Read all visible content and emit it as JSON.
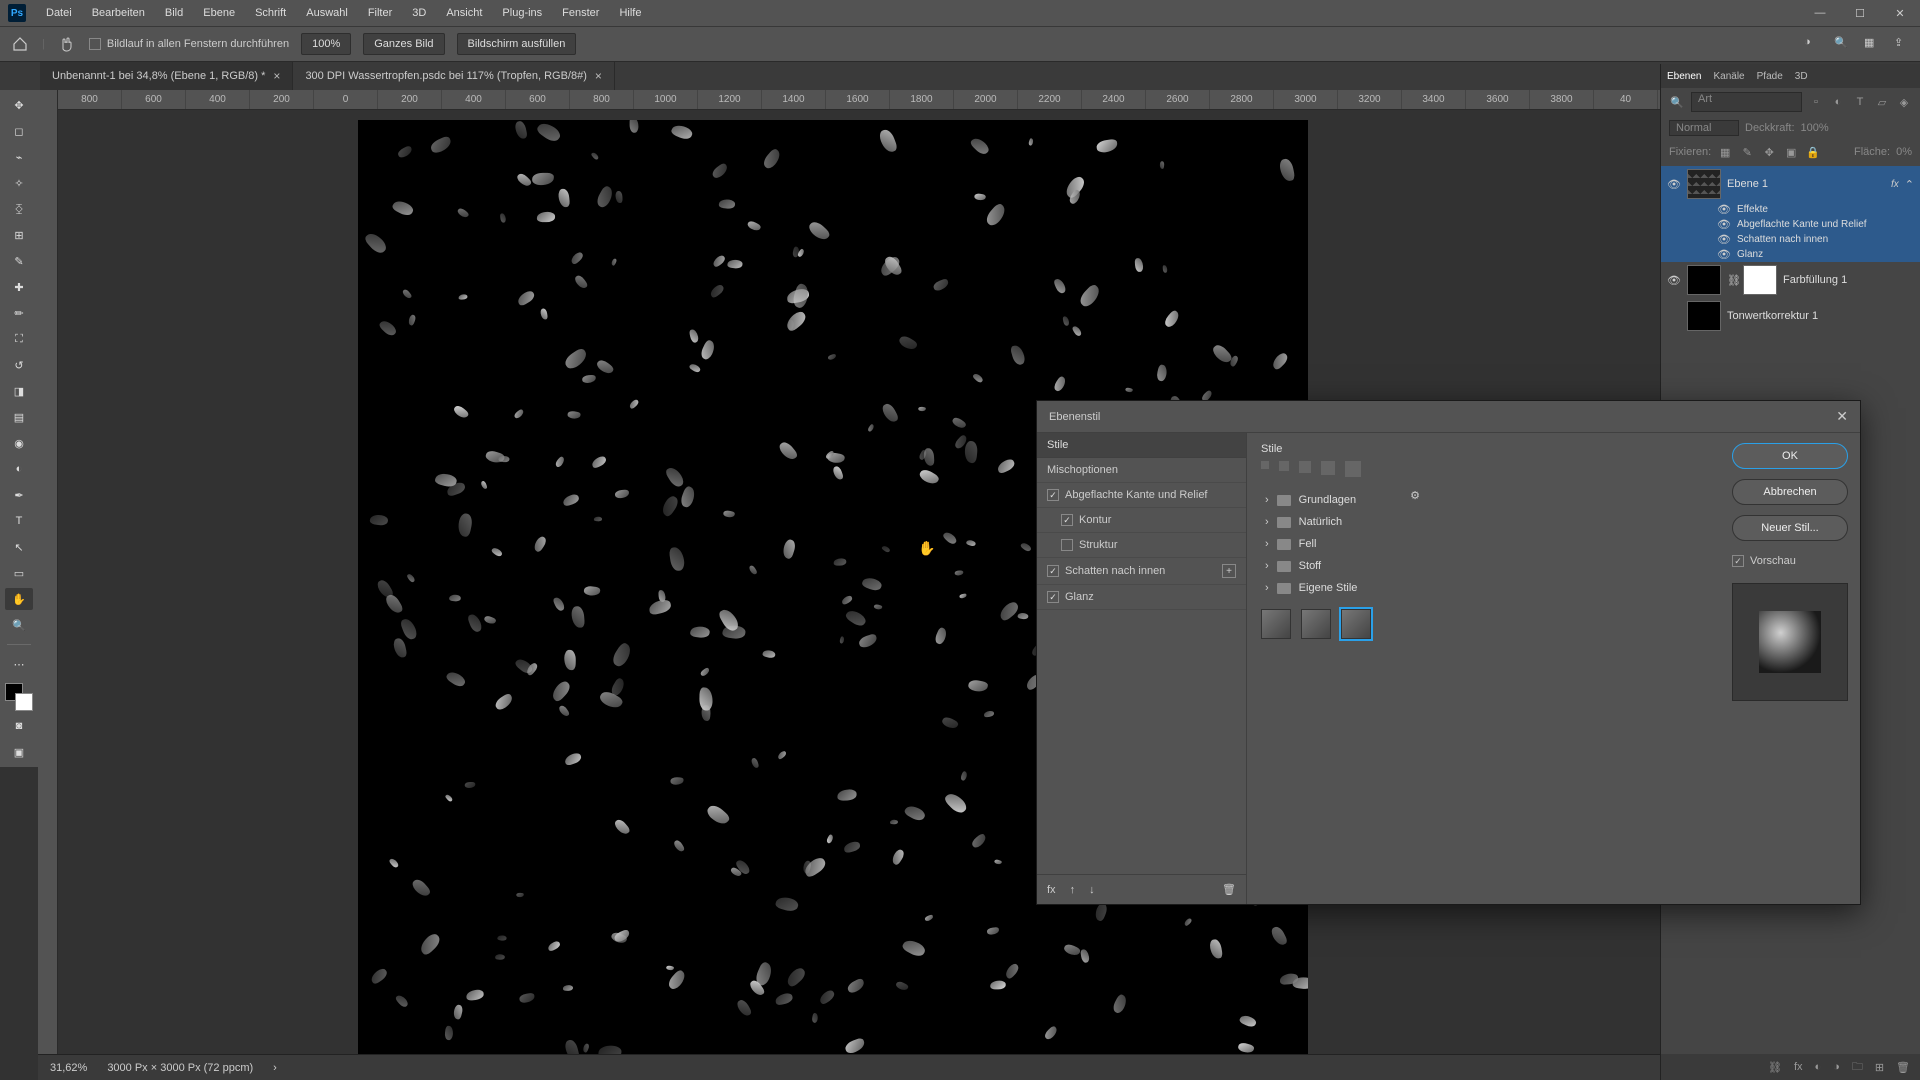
{
  "menu": {
    "items": [
      "Datei",
      "Bearbeiten",
      "Bild",
      "Ebene",
      "Schrift",
      "Auswahl",
      "Filter",
      "3D",
      "Ansicht",
      "Plug-ins",
      "Fenster",
      "Hilfe"
    ]
  },
  "optbar": {
    "scroll_all_label": "Bildlauf in allen Fenstern durchführen",
    "zoom": "100%",
    "fit_image": "Ganzes Bild",
    "fill_screen": "Bildschirm ausfüllen"
  },
  "tabs": [
    {
      "label": "Unbenannt-1 bei 34,8% (Ebene 1, RGB/8) *",
      "active": true
    },
    {
      "label": "300 DPI Wassertropfen.psdc bei 117% (Tropfen, RGB/8#)",
      "active": false
    }
  ],
  "ruler": [
    "800",
    "600",
    "400",
    "200",
    "0",
    "200",
    "400",
    "600",
    "800",
    "1000",
    "1200",
    "1400",
    "1600",
    "1800",
    "2000",
    "2200",
    "2400",
    "2600",
    "2800",
    "3000",
    "3200",
    "3400",
    "3600",
    "3800",
    "40"
  ],
  "panels": {
    "tabs": [
      "Ebenen",
      "Kanäle",
      "Pfade",
      "3D"
    ],
    "search_placeholder": "Art",
    "blend_mode": "Normal",
    "opacity_label": "Deckkraft:",
    "opacity_value": "100%",
    "lock_label": "Fixieren:",
    "fill_label": "Fläche:",
    "fill_value": "0%",
    "layer1": {
      "name": "Ebene 1",
      "fx_label": "fx",
      "effects_label": "Effekte",
      "fx_items": [
        "Abgeflachte Kante und Relief",
        "Schatten nach innen",
        "Glanz"
      ]
    },
    "layer2": {
      "name": "Farbfüllung 1"
    },
    "layer3": {
      "name": "Tonwertkorrektur 1"
    }
  },
  "dialog": {
    "title": "Ebenenstil",
    "left_header": "Stile",
    "items": {
      "blend": "Mischoptionen",
      "bevel": "Abgeflachte Kante und Relief",
      "contour": "Kontur",
      "texture": "Struktur",
      "inner_shadow": "Schatten nach innen",
      "satin": "Glanz"
    },
    "mid_label": "Stile",
    "folders": [
      "Grundlagen",
      "Natürlich",
      "Fell",
      "Stoff",
      "Eigene Stile"
    ],
    "buttons": {
      "ok": "OK",
      "cancel": "Abbrechen",
      "new_style": "Neuer Stil..."
    },
    "preview_label": "Vorschau"
  },
  "status": {
    "zoom": "31,62%",
    "docinfo": "3000 Px × 3000 Px (72 ppcm)"
  }
}
